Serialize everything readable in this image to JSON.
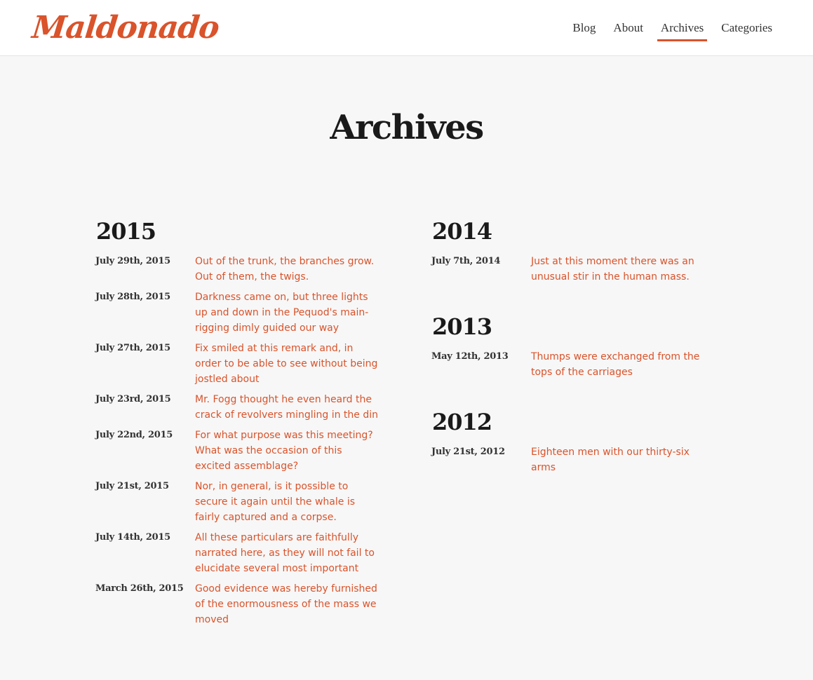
{
  "header": {
    "logo_text": "Maldonado",
    "nav": [
      "Blog",
      "About",
      "Archives",
      "Categories"
    ],
    "active_nav": "Archives"
  },
  "page": {
    "title": "Archives"
  },
  "colors": {
    "accent": "#d9532b",
    "background": "#f7f7f7",
    "header_bg": "#ffffff"
  },
  "archives": [
    {
      "year": "2015",
      "posts": [
        {
          "date": "July 29th, 2015",
          "title": "Out of the trunk, the branches grow. Out of them, the twigs."
        },
        {
          "date": "July 28th, 2015",
          "title": "Darkness came on, but three lights up and down in the Pequod's main-rigging dimly guided our way"
        },
        {
          "date": "July 27th, 2015",
          "title": "Fix smiled at this remark and, in order to be able to see without being jostled about"
        },
        {
          "date": "July 23rd, 2015",
          "title": "Mr. Fogg thought he even heard the crack of revolvers mingling in the din"
        },
        {
          "date": "July 22nd, 2015",
          "title": "For what purpose was this meeting? What was the occasion of this excited assemblage?"
        },
        {
          "date": "July 21st, 2015",
          "title": "Nor, in general, is it possible to secure it again until the whale is fairly captured and a corpse."
        },
        {
          "date": "July 14th, 2015",
          "title": "All these particulars are faithfully narrated here, as they will not fail to elucidate several most important"
        },
        {
          "date": "March 26th, 2015",
          "title": "Good evidence was hereby furnished of the enormousness of the mass we moved"
        }
      ]
    },
    {
      "year": "2014",
      "posts": [
        {
          "date": "July 7th, 2014",
          "title": "Just at this moment there was an unusual stir in the human mass."
        }
      ]
    },
    {
      "year": "2013",
      "posts": [
        {
          "date": "May 12th, 2013",
          "title": "Thumps were exchanged from the tops of the carriages"
        }
      ]
    },
    {
      "year": "2012",
      "posts": [
        {
          "date": "July 21st, 2012",
          "title": "Eighteen men with our thirty-six arms"
        }
      ]
    }
  ]
}
